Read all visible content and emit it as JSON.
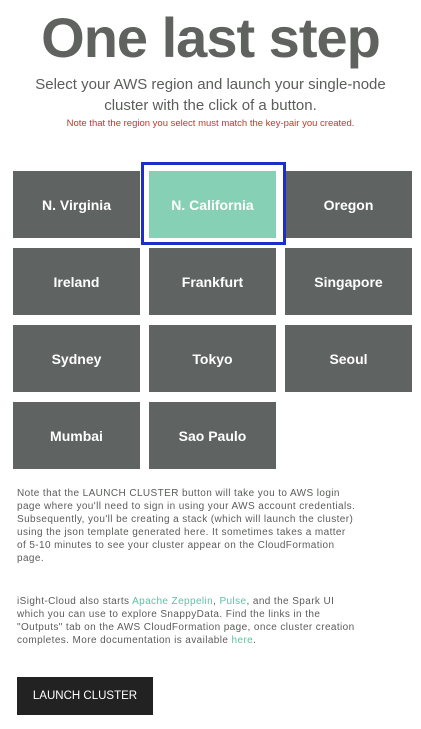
{
  "header": {
    "title": "One last step",
    "subtitle": "Select your AWS region and launch your single-node cluster with the click of a button.",
    "warning": "Note that the region you select must match the key-pair you created."
  },
  "regions": [
    {
      "label": "N. Virginia",
      "selected": false
    },
    {
      "label": "N. California",
      "selected": true
    },
    {
      "label": "Oregon",
      "selected": false
    },
    {
      "label": "Ireland",
      "selected": false
    },
    {
      "label": "Frankfurt",
      "selected": false
    },
    {
      "label": "Singapore",
      "selected": false
    },
    {
      "label": "Sydney",
      "selected": false
    },
    {
      "label": "Tokyo",
      "selected": false
    },
    {
      "label": "Seoul",
      "selected": false
    },
    {
      "label": "Mumbai",
      "selected": false
    },
    {
      "label": "Sao Paulo",
      "selected": false
    }
  ],
  "info": {
    "launch_note": "Note that the LAUNCH CLUSTER button will take you to AWS login page where you'll need to sign in using your AWS account credentials. Subsequently, you'll be creating a stack (which will launch the cluster) using the json template generated here. It sometimes takes a matter of 5-10 minutes to see your cluster appear on the CloudFormation page.",
    "p2_start": "iSight-Cloud also starts ",
    "link_zeppelin": "Apache Zeppelin",
    "p2_sep": ", ",
    "link_pulse": "Pulse",
    "p2_mid": ", and the Spark UI which you can use to explore SnappyData. Find the links in the \"Outputs\" tab on the AWS CloudFormation page, once cluster creation completes. More documentation is available ",
    "link_here": "here",
    "p2_end": "."
  },
  "actions": {
    "launch_label": "LAUNCH CLUSTER"
  },
  "colors": {
    "tile": "#5f6361",
    "tile_selected": "#86d0b5",
    "selection_border": "#1f2ec8",
    "warning": "#c0392b",
    "link": "#5fc0a4"
  }
}
